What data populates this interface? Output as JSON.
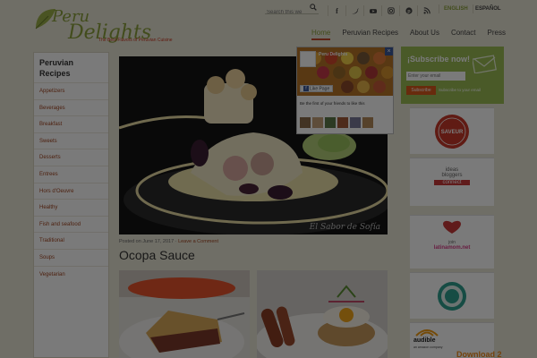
{
  "header": {
    "logo_peru": "Peru",
    "logo_delights": "Delights",
    "tagline": "The Best Flavors of Peruvian Cuisine",
    "search_placeholder": "Search this we",
    "social_icons": [
      "facebook-icon",
      "twitter-icon",
      "youtube-icon",
      "instagram-icon",
      "pinterest-icon",
      "rss-icon"
    ],
    "lang_en": "ENGLISH",
    "lang_es": "ESPAÑOL",
    "nav": [
      {
        "label": "Home",
        "active": true
      },
      {
        "label": "Peruvian Recipes",
        "active": false
      },
      {
        "label": "About Us",
        "active": false
      },
      {
        "label": "Contact",
        "active": false
      },
      {
        "label": "Press",
        "active": false
      }
    ]
  },
  "sidebar": {
    "title": "Peruvian Recipes",
    "items": [
      "Appetizers",
      "Beverages",
      "Breakfast",
      "Sweets",
      "Desserts",
      "Entrees",
      "Hors d'Oeuvre",
      "Healthy",
      "Fish and seafood",
      "Traditional",
      "Soups",
      "Vegetarian"
    ]
  },
  "post": {
    "meta_prefix": "Posted on June 17, 2017 · ",
    "meta_link": "Leave a Comment",
    "title": "Ocopa Sauce",
    "watermark": "El Sabor de Sofía"
  },
  "popup": {
    "page_name": "Peru Delights",
    "like_label": "Like Page",
    "friends_text": "Be the first of your friends to like this",
    "close_label": "×"
  },
  "subscribe": {
    "title": "¡Subscribe now!",
    "email_placeholder": "Enter your email",
    "button": "Subscribe",
    "note": "Subscribe to your email"
  },
  "right_sidebar": {
    "badge1": "SAVEUR",
    "idea_top": "ideas",
    "idea_mid": "bloggers",
    "idea_bottom": "connect",
    "join": "join",
    "latina": "latinamom.net",
    "audible": "audible",
    "audible_sub": "an amazon company",
    "download": "Download 2"
  },
  "colors": {
    "accent_green": "#8aa03c",
    "accent_red": "#c04a2c",
    "subscribe_bg": "#9bbd55"
  }
}
